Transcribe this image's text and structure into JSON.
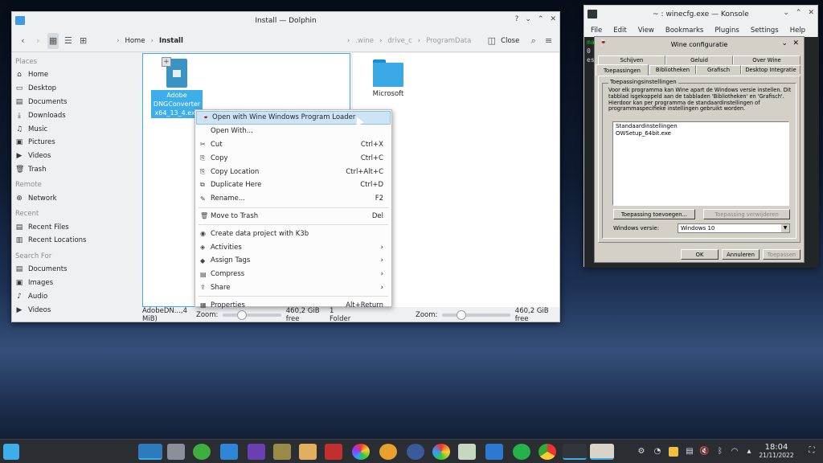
{
  "dolphin": {
    "title": "Install — Dolphin",
    "breadcrumb": {
      "home": "Home",
      "current": "Install",
      "right": [
        ".wine",
        "drive_c",
        "ProgramData"
      ]
    },
    "close_label": "Close",
    "sidebar": {
      "places_header": "Places",
      "places": [
        {
          "label": "Home",
          "icon": "home-icon"
        },
        {
          "label": "Desktop",
          "icon": "desktop-icon"
        },
        {
          "label": "Documents",
          "icon": "documents-icon"
        },
        {
          "label": "Downloads",
          "icon": "downloads-icon"
        },
        {
          "label": "Music",
          "icon": "music-icon"
        },
        {
          "label": "Pictures",
          "icon": "pictures-icon"
        },
        {
          "label": "Videos",
          "icon": "videos-icon"
        },
        {
          "label": "Trash",
          "icon": "trash-icon"
        }
      ],
      "remote_header": "Remote",
      "remote": [
        {
          "label": "Network",
          "icon": "network-icon"
        }
      ],
      "recent_header": "Recent",
      "recent": [
        {
          "label": "Recent Files",
          "icon": "recent-files-icon"
        },
        {
          "label": "Recent Locations",
          "icon": "recent-locations-icon"
        }
      ],
      "search_header": "Search For",
      "search": [
        {
          "label": "Documents",
          "icon": "documents-icon"
        },
        {
          "label": "Images",
          "icon": "images-icon"
        },
        {
          "label": "Audio",
          "icon": "audio-icon"
        },
        {
          "label": "Videos",
          "icon": "videos-icon"
        }
      ]
    },
    "left_file": {
      "line1": "Adobe",
      "line2": "DNGConverter",
      "line3": "x64_13_4.exe"
    },
    "right_folder": "Microsoft",
    "status_left": {
      "selection": "AdobeDN...,4 MiB)",
      "zoom": "Zoom:",
      "free": "460,2 GiB free",
      "count": "1 Folder"
    },
    "status_right": {
      "zoom": "Zoom:",
      "free": "460,2 GiB free"
    }
  },
  "context_menu": {
    "items": [
      {
        "label": "Open with Wine Windows Program Loader",
        "shortcut": "",
        "icon": "wine-icon",
        "highlight": true
      },
      {
        "label": "Open With...",
        "shortcut": "",
        "icon": ""
      },
      {
        "label": "Cut",
        "shortcut": "Ctrl+X",
        "icon": "scissors-icon"
      },
      {
        "label": "Copy",
        "shortcut": "Ctrl+C",
        "icon": "copy-icon"
      },
      {
        "label": "Copy Location",
        "shortcut": "Ctrl+Alt+C",
        "icon": "copy-location-icon"
      },
      {
        "label": "Duplicate Here",
        "shortcut": "Ctrl+D",
        "icon": "duplicate-icon"
      },
      {
        "label": "Rename...",
        "shortcut": "F2",
        "icon": "rename-icon"
      },
      {
        "sep": true
      },
      {
        "label": "Move to Trash",
        "shortcut": "Del",
        "icon": "trash-icon"
      },
      {
        "sep": true
      },
      {
        "label": "Create data project with K3b",
        "shortcut": "",
        "icon": "k3b-icon"
      },
      {
        "label": "Activities",
        "shortcut": "›",
        "icon": "activities-icon"
      },
      {
        "label": "Assign Tags",
        "shortcut": "›",
        "icon": "tag-icon"
      },
      {
        "label": "Compress",
        "shortcut": "›",
        "icon": "compress-icon"
      },
      {
        "label": "Share",
        "shortcut": "›",
        "icon": "share-icon"
      },
      {
        "sep": true
      },
      {
        "label": "Properties",
        "shortcut": "Alt+Return",
        "icon": "properties-icon"
      }
    ]
  },
  "konsole": {
    "title": "~ : winecfg.exe — Konsole",
    "menu": [
      "File",
      "Edit",
      "View",
      "Bookmarks",
      "Plugins",
      "Settings",
      "Help"
    ],
    "term_lines": [
      "ma",
      "0",
      "es"
    ]
  },
  "wine": {
    "title": "Wine configuratie",
    "tabs_top": [
      "Schijven",
      "Geluid",
      "Over Wine"
    ],
    "tabs_bottom": [
      "Toepassingen",
      "Bibliotheken",
      "Grafisch",
      "Desktop Integratie"
    ],
    "group_title": "Toepassingsinstellingen",
    "description": "Voor elk programma kan Wine apart de Windows versie instellen. Dit tabblad isgekoppeld aan de tabbladen 'Bibliotheken' en 'Grafisch'. Hierdoor kan per programma de standaardinstellingen of programmaspecifieke instellingen gebruikt worden.",
    "list": [
      "Standaardinstellingen",
      "OWSetup_64bit.exe"
    ],
    "add_button": "Toepassing toevoegen...",
    "remove_button": "Toepassing verwijderen",
    "version_label": "Windows versie:",
    "version_value": "Windows 10",
    "ok": "OK",
    "cancel": "Annuleren",
    "apply": "Toepassen"
  },
  "taskbar": {
    "time": "18:04",
    "date": "21/11/2022"
  }
}
